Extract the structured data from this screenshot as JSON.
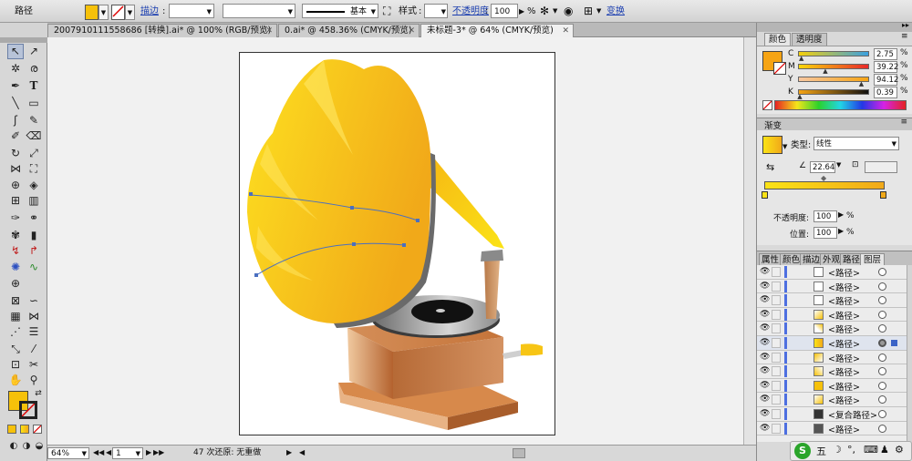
{
  "control_bar": {
    "object_type": "路径",
    "stroke_label": "描边",
    "stroke_weight": "",
    "stroke_style": "基本",
    "style_label": "样式",
    "opacity_label": "不透明度",
    "opacity_value": "100",
    "opacity_unit": "%",
    "transform_link": "变换",
    "fill_color": "#f6c10a"
  },
  "doc_tabs": [
    {
      "label": "2007910111558686 [转换].ai* @ 100% (RGB/预览)"
    },
    {
      "label": "0.ai* @ 458.36% (CMYK/预览)"
    },
    {
      "label": "未标题-3* @ 64% (CMYK/预览)"
    }
  ],
  "color_panel": {
    "tab_color": "颜色",
    "tab_opacity": "透明度",
    "channels": [
      {
        "letter": "C",
        "value": "2.75",
        "fraction": 0.0275
      },
      {
        "letter": "M",
        "value": "39.22",
        "fraction": 0.3922
      },
      {
        "letter": "Y",
        "value": "94.12",
        "fraction": 0.9412
      },
      {
        "letter": "K",
        "value": "0.39",
        "fraction": 0.0039
      }
    ],
    "unit": "%",
    "current_color": "#f6a414"
  },
  "gradient_panel": {
    "title": "渐变",
    "type_label": "类型:",
    "type_value": "线性",
    "angle_value": "22.64",
    "opacity_label": "不透明度:",
    "opacity_value": "100",
    "location_label": "位置:",
    "location_value": "100",
    "unit": "%",
    "stop_start": "#fbe316",
    "stop_end": "#f1a919"
  },
  "layers_panel": {
    "tabs": [
      "属性",
      "颜色",
      "描边",
      "外观",
      "路径",
      "图层"
    ],
    "rows": [
      {
        "name": "<路径>"
      },
      {
        "name": "<路径>"
      },
      {
        "name": "<路径>"
      },
      {
        "name": "<路径>"
      },
      {
        "name": "<路径>"
      },
      {
        "name": "<路径>"
      },
      {
        "name": "<路径>"
      },
      {
        "name": "<路径>"
      },
      {
        "name": "<路径>"
      },
      {
        "name": "<路径>"
      },
      {
        "name": "<复合路径>"
      },
      {
        "name": "<路径>"
      }
    ]
  },
  "status_bar": {
    "zoom": "64%",
    "page": "1",
    "message": "47 次还原: 无重做"
  },
  "taskbar": {
    "app_letter": "S",
    "ime_char": "五"
  }
}
